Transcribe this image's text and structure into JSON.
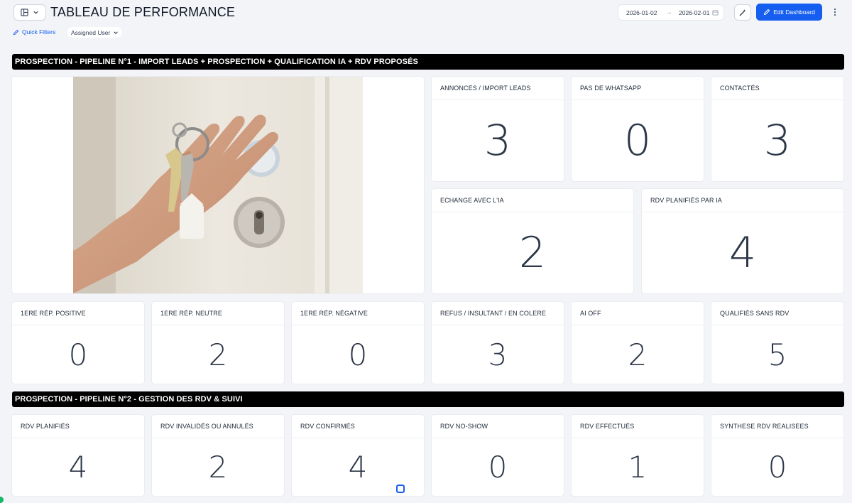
{
  "header": {
    "title": "TABLEAU DE PERFORMANCE",
    "date_start": "2026-01-02",
    "date_end": "2026-02-01",
    "edit_label": "Edit Dashboard",
    "accent": "#155eef"
  },
  "filters": {
    "quick_filters_label": "Quick Filters",
    "assigned_user_label": "Assigned User"
  },
  "sections": [
    {
      "title": "PROSPECTION - PIPELINE N°1 - IMPORT LEADS + PROSPECTION + QUALIFICATION IA + RDV PROPOSÉS"
    },
    {
      "title": "PROSPECTION - PIPELINE N°2 - GESTION DES RDV & SUIVI"
    }
  ],
  "pipeline1": {
    "top": [
      {
        "title": "ANNONCES / IMPORT LEADS",
        "value": "3"
      },
      {
        "title": "PAS DE WHATSAPP",
        "value": "0"
      },
      {
        "title": "CONTACTÉS",
        "value": "3"
      }
    ],
    "middle": [
      {
        "title": "ECHANGE AVEC L'IA",
        "value": "2"
      },
      {
        "title": "RDV PLANIFIÉS PAR IA",
        "value": "4"
      }
    ],
    "bottom": [
      {
        "title": "1ERE RÉP. POSITIVE",
        "value": "0"
      },
      {
        "title": "1ERE RÉP. NEUTRE",
        "value": "2"
      },
      {
        "title": "1ERE RÉP. NÉGATIVE",
        "value": "0"
      },
      {
        "title": "REFUS / INSULTANT / EN COLERE",
        "value": "3"
      },
      {
        "title": "AI OFF",
        "value": "2"
      },
      {
        "title": "QUALIFIÉS SANS RDV",
        "value": "5"
      }
    ]
  },
  "pipeline2": {
    "cards": [
      {
        "title": "RDV PLANIFIÉS",
        "value": "4"
      },
      {
        "title": "RDV INVALIDÉS OU ANNULÉS",
        "value": "2"
      },
      {
        "title": "RDV CONFIRMÉS",
        "value": "4"
      },
      {
        "title": "RDV NO-SHOW",
        "value": "0"
      },
      {
        "title": "RDV EFFECTUÉS",
        "value": "1"
      },
      {
        "title": "SYNTHESE RDV REALISEES",
        "value": "0"
      }
    ]
  }
}
